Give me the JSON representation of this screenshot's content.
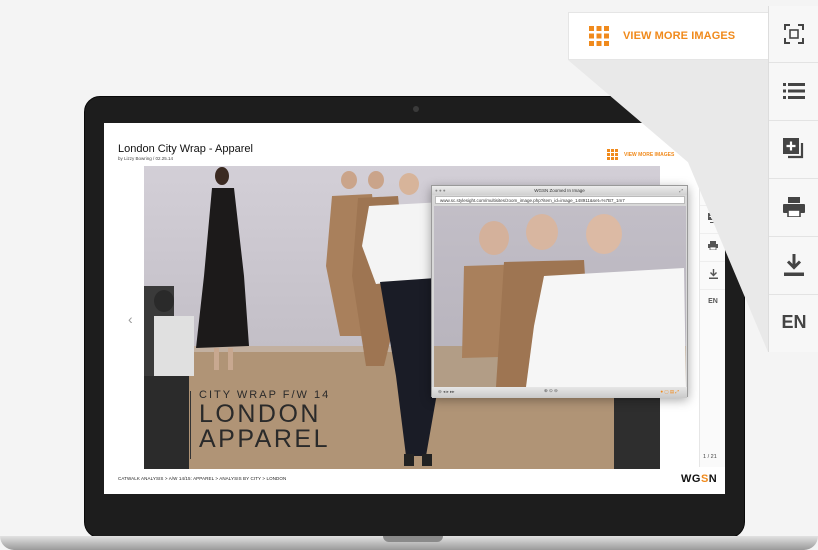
{
  "colors": {
    "accent": "#f08a1c",
    "laptop_frame": "#1d1d1d",
    "toolbar_bg": "#f7f7f7"
  },
  "outer_toolbar": {
    "view_more_label": "VIEW MORE IMAGES",
    "items": [
      {
        "icon": "fullscreen-icon"
      },
      {
        "icon": "list-icon"
      },
      {
        "icon": "add-to-board-icon"
      },
      {
        "icon": "print-icon"
      },
      {
        "icon": "download-icon"
      },
      {
        "icon": "language-icon",
        "label": "EN"
      }
    ]
  },
  "screen": {
    "title": "London City Wrap - Apparel",
    "byline": "by Lizzy Bowring / 02.25.14",
    "view_more_label": "VIEW MORE IMAGES",
    "language": "EN",
    "image_counter": "1 / 21",
    "overlay_line1": "CITY WRAP F/W 14",
    "overlay_line2": "LONDON",
    "overlay_line3": "APPAREL",
    "breadcrumb": "CATWALK ANALYSIS > A/W 14/15: APPAREL > ANALYSIS BY CITY > LONDON",
    "brand_prefix": "WG",
    "brand_o": "S",
    "brand_suffix": "N"
  },
  "zoom_window": {
    "title": "WGSN Zoomed In Image",
    "url": "www.sc.stylesight.com/multisites/zoom_image.php?item_id=image_148911&set=%7B7_1m7"
  }
}
